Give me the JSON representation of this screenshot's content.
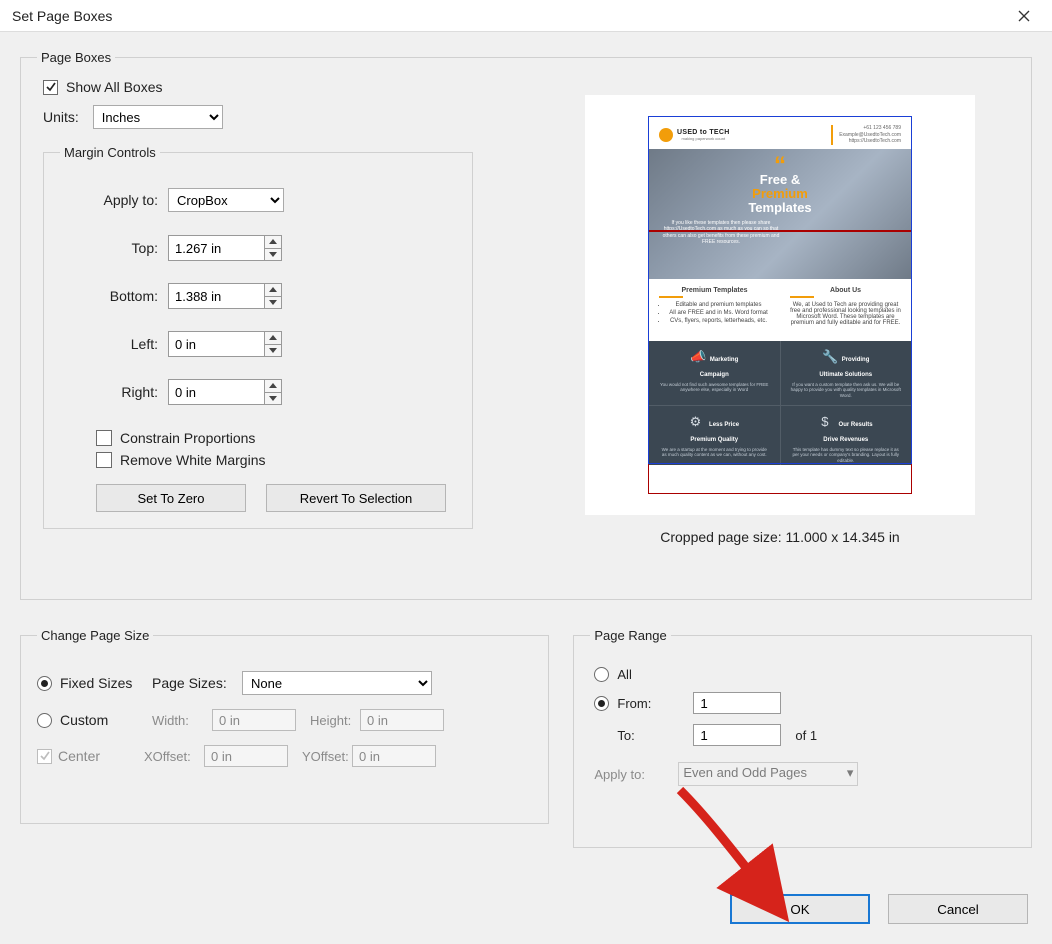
{
  "window": {
    "title": "Set Page Boxes"
  },
  "page_boxes": {
    "legend": "Page Boxes",
    "show_all_boxes_label": "Show All Boxes",
    "show_all_boxes_checked": true,
    "units_label": "Units:",
    "units_value": "Inches",
    "margin_controls": {
      "legend": "Margin Controls",
      "apply_to_label": "Apply to:",
      "apply_to_value": "CropBox",
      "top_label": "Top:",
      "top_value": "1.267 in",
      "bottom_label": "Bottom:",
      "bottom_value": "1.388 in",
      "left_label": "Left:",
      "left_value": "0 in",
      "right_label": "Right:",
      "right_value": "0 in",
      "constrain_label": "Constrain Proportions",
      "constrain_checked": false,
      "remove_wm_label": "Remove White Margins",
      "remove_wm_checked": false,
      "set_to_zero": "Set To Zero",
      "revert_to_selection": "Revert To Selection"
    },
    "preview": {
      "cropped_label": "Cropped page size: 11.000 x 14.345 in",
      "doc": {
        "brand": "USED to TECH",
        "tagline": "making paperwork count",
        "phone": "+61 123 456 789",
        "email": "Example@UsedtoTech.com",
        "site": "https://UsedtoTech.com",
        "hero_line1": "Free &",
        "hero_line2": "Premium",
        "hero_line3": "Templates",
        "hero_body": "If you like these templates then please share https://UsedtoTech.com as much as you can so that others can also get benefits from these premium and FREE resources.",
        "col1_title": "Premium Templates",
        "col1_items": [
          "Editable and premium templates",
          "All are FREE and in Ms. Word format",
          "CVs, flyers, reports, letterheads, etc."
        ],
        "col2_title": "About Us",
        "col2_body": "We, at Used to Tech are providing great free and professional looking templates in Microsoft Word. These templates are premium and fully editable and for FREE.",
        "cells": [
          {
            "t1": "Marketing",
            "t2": "Campaign",
            "body": "You would not find such awesome templates for FREE anywhere else, especially in Word"
          },
          {
            "t1": "Providing",
            "t2": "Ultimate Solutions",
            "body": "If you want a custom template then ask us. We will be happy to provide you with quality templates in Microsoft Word."
          },
          {
            "t1": "Less Price",
            "t2": "Premium Quality",
            "body": "We are a startup at the moment and trying to provide as much quality content as we can, without any cost."
          },
          {
            "t1": "Our Results",
            "t2": "Drive Revenues",
            "body": "This template has dummy text so please replace it as per your needs or company's branding. Layout is fully editable."
          }
        ]
      }
    }
  },
  "change_page_size": {
    "legend": "Change Page Size",
    "fixed_sizes_label": "Fixed Sizes",
    "custom_label": "Custom",
    "center_label": "Center",
    "page_sizes_label": "Page Sizes:",
    "page_sizes_value": "None",
    "width_label": "Width:",
    "width_value": "0 in",
    "height_label": "Height:",
    "height_value": "0 in",
    "xoffset_label": "XOffset:",
    "xoffset_value": "0 in",
    "yoffset_label": "YOffset:",
    "yoffset_value": "0 in",
    "fixed_selected": true,
    "custom_selected": false,
    "center_checked": true
  },
  "page_range": {
    "legend": "Page Range",
    "all_label": "All",
    "from_label": "From:",
    "to_label": "To:",
    "of_label": "of 1",
    "from_value": "1",
    "to_value": "1",
    "apply_to_label": "Apply to:",
    "apply_to_value": "Even and Odd Pages",
    "all_selected": false,
    "from_selected": true
  },
  "buttons": {
    "ok": "OK",
    "cancel": "Cancel"
  }
}
